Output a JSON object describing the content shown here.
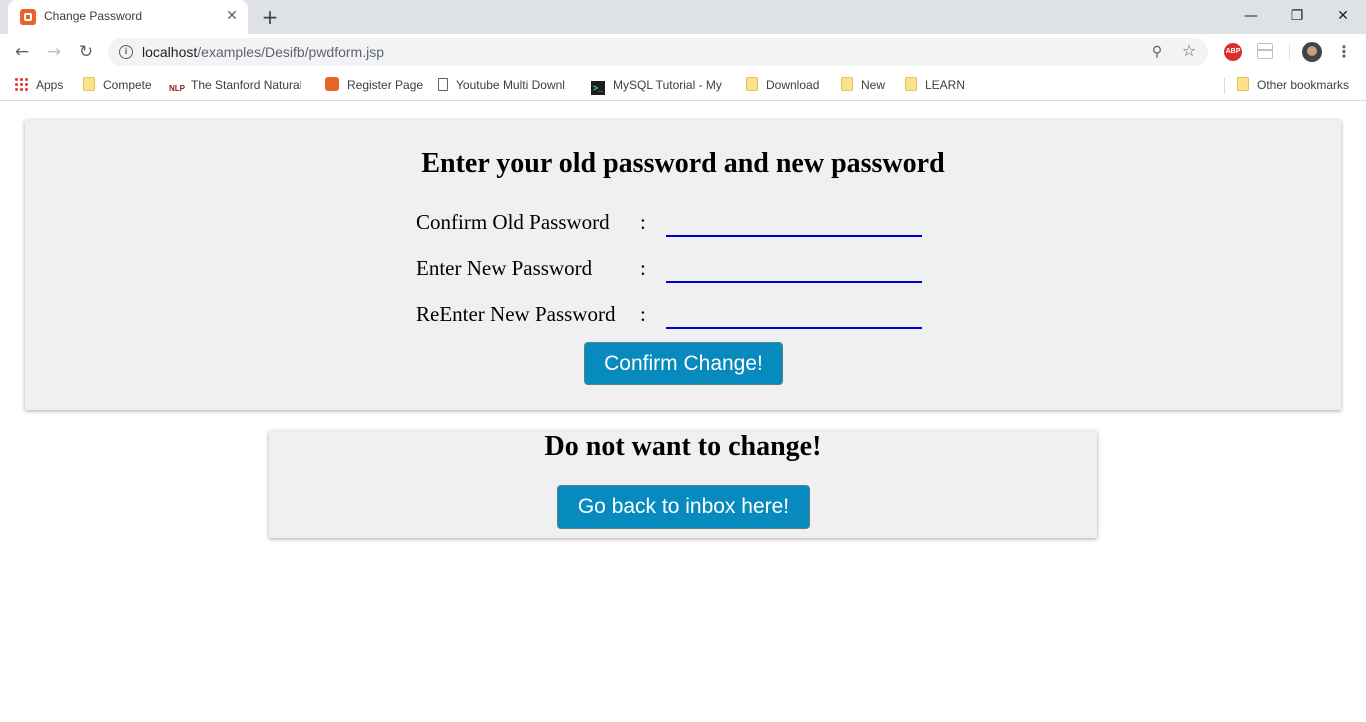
{
  "browser": {
    "tab_title": "Change Password",
    "tab_close": "✕",
    "new_tab": "+",
    "window": {
      "minimize": "—",
      "restore": "❐",
      "close": "✕"
    },
    "nav": {
      "back": "←",
      "forward": "→",
      "reload": "↻"
    },
    "url_host": "localhost",
    "url_path": "/examples/Desifb/pwdform.jsp",
    "info_glyph": "i",
    "zoom_glyph": "⚲",
    "star_glyph": "☆",
    "abp_label": "ABP",
    "menu_glyph": "⋮"
  },
  "bookmarks": {
    "items": [
      {
        "label": "Apps",
        "icon": "apps-icon"
      },
      {
        "label": "Compete",
        "icon": "folder-icon"
      },
      {
        "label": "The Stanford Natural",
        "icon": "nlp-icon",
        "icon_text": "NLP"
      },
      {
        "label": "Register Page",
        "icon": "xampp-icon"
      },
      {
        "label": "Youtube Multi Downl",
        "icon": "page-icon"
      },
      {
        "label": "MySQL Tutorial - My",
        "icon": "terminal-icon",
        "icon_text": ">_"
      },
      {
        "label": "Download",
        "icon": "folder-icon"
      },
      {
        "label": "New",
        "icon": "folder-icon"
      },
      {
        "label": "LEARN",
        "icon": "folder-icon"
      }
    ],
    "other": {
      "label": "Other bookmarks",
      "icon": "folder-icon"
    }
  },
  "change_form": {
    "heading": "Enter your old password and new password",
    "fields": [
      {
        "label": "Confirm Old Password",
        "colon": ":",
        "value": ""
      },
      {
        "label": "Enter New Password",
        "colon": ":",
        "value": ""
      },
      {
        "label": "ReEnter New Password",
        "colon": ":",
        "value": ""
      }
    ],
    "submit_label": "Confirm Change!"
  },
  "back_panel": {
    "heading": "Do not want to change!",
    "button_label": "Go back to inbox here!"
  },
  "colors": {
    "button_bg": "#078bbf",
    "input_underline": "#0000cd",
    "card_bg": "#f0f0f0"
  }
}
